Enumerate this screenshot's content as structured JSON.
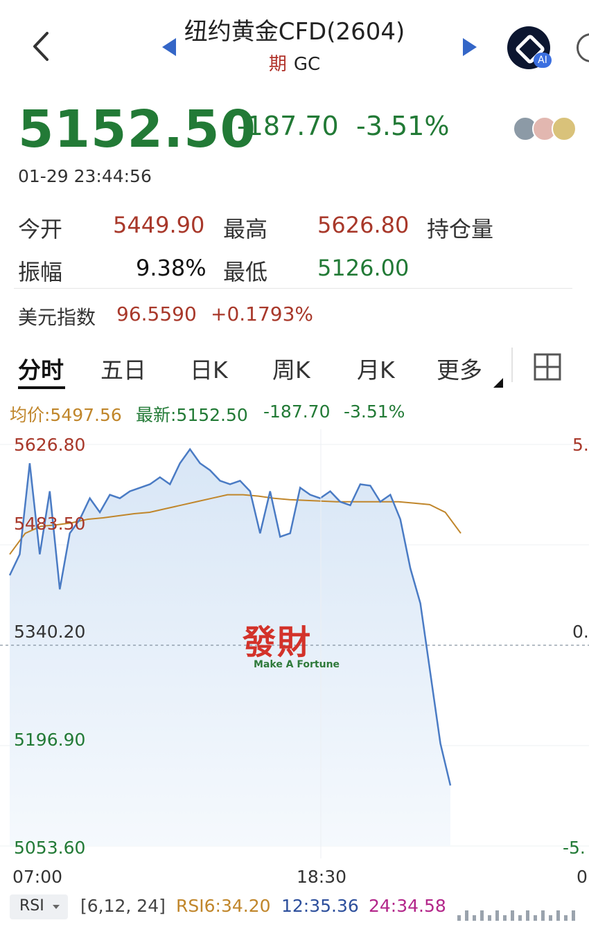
{
  "header": {
    "title": "纽约黄金CFD(2604)",
    "sub_prefix": "期",
    "sub_code": "GC",
    "ai_label": "AI"
  },
  "quote": {
    "price": "5152.50",
    "change": "-187.70",
    "change_pct": "-3.51%",
    "timestamp": "01-29 23:44:56"
  },
  "stats": {
    "open_label": "今开",
    "open_value": "5449.90",
    "high_label": "最高",
    "high_value": "5626.80",
    "oi_label": "持仓量",
    "amp_label": "振幅",
    "amp_value": "9.38%",
    "low_label": "最低",
    "low_value": "5126.00"
  },
  "usd_index": {
    "label": "美元指数",
    "value": "96.5590",
    "change": "+0.1793%"
  },
  "tabs": [
    {
      "label": "分时",
      "active": true
    },
    {
      "label": "五日"
    },
    {
      "label": "日K"
    },
    {
      "label": "周K"
    },
    {
      "label": "月K"
    },
    {
      "label": "更多"
    }
  ],
  "legend": {
    "avg": "均价:5497.56",
    "latest": "最新:5152.50",
    "change": "-187.70",
    "pct": "-3.51%"
  },
  "chart": {
    "y_labels": [
      "5626.80",
      "5483.50",
      "5340.20",
      "5196.90",
      "5053.60"
    ],
    "right_labels": [
      "5.",
      "0.",
      "-5."
    ],
    "x_labels": [
      "07:00",
      "18:30",
      "0"
    ],
    "watermark_cn": "發財",
    "watermark_en": "Make A Fortune"
  },
  "chart_data": {
    "type": "line",
    "title": "",
    "xlabel": "",
    "ylabel": "",
    "ylim": [
      5053.6,
      5626.8
    ],
    "x_ticks": [
      "07:00",
      "18:30"
    ],
    "reference_price": 5340.2,
    "series": [
      {
        "color": "#4a7bc4",
        "values": [
          5440,
          5470,
          5600,
          5470,
          5560,
          5420,
          5500,
          5520,
          5550,
          5530,
          5555,
          5550,
          5560,
          5565,
          5570,
          5580,
          5570,
          5600,
          5620,
          5600,
          5590,
          5575,
          5570,
          5575,
          5560,
          5500,
          5560,
          5495,
          5500,
          5565,
          5555,
          5550,
          5560,
          5545,
          5540,
          5570,
          5568,
          5545,
          5555,
          5520,
          5450,
          5400,
          5300,
          5200,
          5140
        ]
      },
      {
        "name": "均价",
        "color": "#c0862b",
        "values": [
          5470,
          5500,
          5510,
          5512,
          5515,
          5520,
          5522,
          5525,
          5528,
          5530,
          5535,
          5540,
          5545,
          5550,
          5555,
          5555,
          5553,
          5550,
          5548,
          5547,
          5546,
          5545,
          5545,
          5545,
          5545,
          5545,
          5543,
          5541,
          5530,
          5500
        ]
      }
    ]
  },
  "indicator": {
    "name": "RSI",
    "params": "[6,12, 24]",
    "rsi6": "RSI6:34.20",
    "rsi12": "12:35.36",
    "rsi24": "24:34.58"
  },
  "colors": {
    "up": "#a8382a",
    "down": "#227a36",
    "line": "#4a7bc4",
    "avg": "#c0862b"
  }
}
